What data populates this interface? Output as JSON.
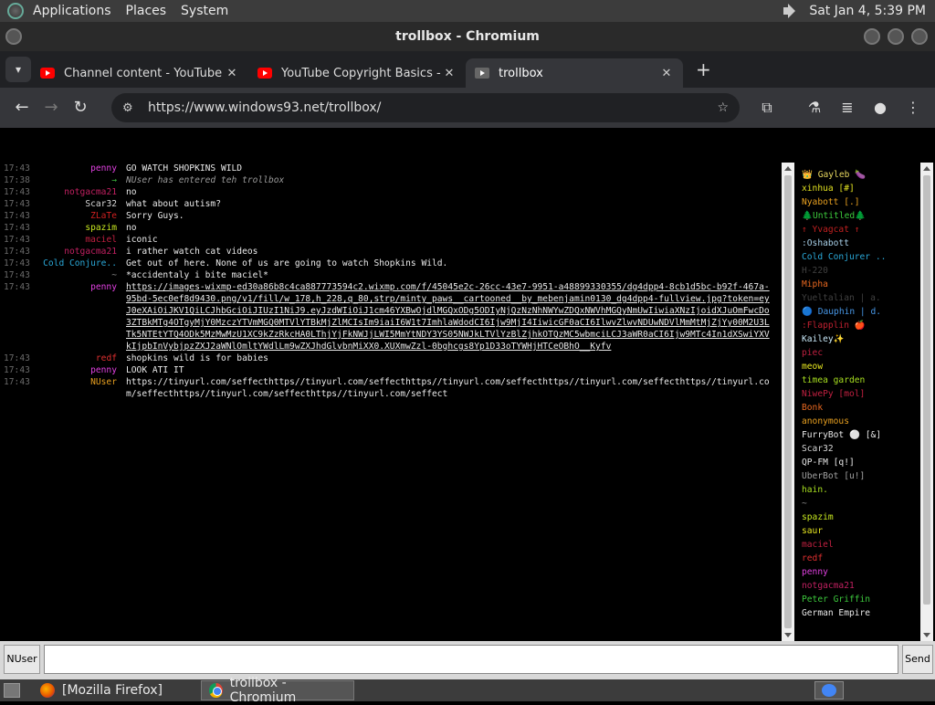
{
  "panel": {
    "menus": [
      "Applications",
      "Places",
      "System"
    ],
    "clock": "Sat Jan  4,  5:39 PM"
  },
  "window": {
    "title": "trollbox - Chromium"
  },
  "tabs": [
    {
      "title": "Channel content - YouTube S",
      "icon": "youtube-icon"
    },
    {
      "title": "YouTube Copyright Basics - Y",
      "icon": "youtube-icon"
    },
    {
      "title": "trollbox",
      "icon": "windows93-icon"
    }
  ],
  "toolbar": {
    "url": "https://www.windows93.net/trollbox/"
  },
  "chat": [
    {
      "time": "17:43",
      "nick": "penny",
      "color": "#e040e0",
      "msg": "GO WATCH SHOPKINS WILD"
    },
    {
      "time": "17:38",
      "nick": "→",
      "color": "#3fb83f",
      "msg": "NUser has entered teh trollbox",
      "system": true
    },
    {
      "time": "17:43",
      "nick": "notgacma21",
      "color": "#c02060",
      "msg": "no"
    },
    {
      "time": "17:43",
      "nick": "Scar32",
      "color": "#d8d8d8",
      "msg": "what about autism?"
    },
    {
      "time": "17:43",
      "nick": "ZLaTe",
      "color": "#d02020",
      "msg": "Sorry Guys."
    },
    {
      "time": "17:43",
      "nick": "spazim",
      "color": "#c8e820",
      "msg": "no"
    },
    {
      "time": "17:43",
      "nick": "maciel",
      "color": "#c02040",
      "msg": "iconic"
    },
    {
      "time": "17:43",
      "nick": "notgacma21",
      "color": "#c02060",
      "msg": "i rather watch cat videos"
    },
    {
      "time": "17:43",
      "nick": "Cold Conjure..",
      "color": "#2aa8d8",
      "msg": "Get out of here. None of us are going to watch Shopkins Wild."
    },
    {
      "time": "17:43",
      "nick": "~",
      "color": "#888888",
      "msg": "*accidentaly i bite maciel*"
    },
    {
      "time": "17:43",
      "nick": "penny",
      "color": "#e040e0",
      "msg": "https://images-wixmp-ed30a86b8c4ca887773594c2.wixmp.com/f/45045e2c-26cc-43e7-9951-a48899330355/dg4dpp4-8cb1d5bc-b92f-467a-95bd-5ec0ef8d9430.png/v1/fill/w_178,h_228,q_80,strp/minty_paws__cartooned__by_mebenjamin0130_dg4dpp4-fullview.jpg?token=eyJ0eXAiOiJKV1QiLCJhbGciOiJIUzI1NiJ9.eyJzdWIiOiJ1cm46YXBwOjdlMGQxODg5ODIyNjQzNzNhNWYwZDQxNWVhMGQyNmUwIiwiaXNzIjoidXJuOmFwcDo3ZTBkMTg4OTgyMjY0MzczYTVmMGQ0MTVlYTBkMjZlMCIsIm9iaiI6W1t7ImhlaWdodCI6Ijw9MjI4IiwicGF0aCI6IlwvZlwvNDUwNDVlMmMtMjZjYy00M2U3LTk5NTEtYTQ4ODk5MzMwMzU1XC9kZzRkcHA0LThjYjFkNWJjLWI5MmYtNDY3YS05NWJkLTVlYzBlZjhkOTQzMC5wbmciLCJ3aWR0aCI6Ijw9MTc4In1dXSwiYXVkIjpbInVybjpzZXJ2aWNlOmltYWdlLm9wZXJhdGlvbnMiXX0.XUXmwZzl-0bghcgs8Yp1D33oTYWHjHTCeOBhO__Kyfv",
      "link": true
    },
    {
      "time": "17:43",
      "nick": "redf",
      "color": "#e03030",
      "msg": "shopkins wild is for babies"
    },
    {
      "time": "17:43",
      "nick": "penny",
      "color": "#e040e0",
      "msg": "LOOK ATI IT"
    },
    {
      "time": "17:43",
      "nick": "NUser",
      "color": "#e8a020",
      "msg": "https://tinyurl.com/seffecthttps//tinyurl.com/seffecthttps//tinyurl.com/seffecthttps//tinyurl.com/seffecthttps//tinyurl.com/seffecthttps//tinyurl.com/seffecthttps//tinyurl.com/seffect"
    }
  ],
  "users": [
    {
      "name": "👑 Gayleb 🍆",
      "color": "#e8d860"
    },
    {
      "name": "xinhua [#]",
      "color": "#e0e020"
    },
    {
      "name": "Nyabott [.]",
      "color": "#e8a020"
    },
    {
      "name": "🌲Untitled🌲",
      "color": "#3cc83c"
    },
    {
      "name": "↑ Yvagcat ↑",
      "color": "#c02020"
    },
    {
      "name": ":Oshabott",
      "color": "#a8d0e8"
    },
    {
      "name": "Cold Conjurer ..",
      "color": "#2aa8d8"
    },
    {
      "name": "H-220",
      "color": "#404040"
    },
    {
      "name": "Mipha",
      "color": "#e86820"
    },
    {
      "name": "Yueltalian | a.",
      "color": "#404040"
    },
    {
      "name": "🔵 Dauphin | d.",
      "color": "#4898e8"
    },
    {
      "name": ":Flapplin 🍎",
      "color": "#c02030"
    },
    {
      "name": "Kailey✨",
      "color": "#c8e8f8"
    },
    {
      "name": "piec",
      "color": "#c02040"
    },
    {
      "name": "meow",
      "color": "#e8e820"
    },
    {
      "name": "timea garden",
      "color": "#a8e020"
    },
    {
      "name": "NiwePy [mol]",
      "color": "#c02040"
    },
    {
      "name": "Bonk",
      "color": "#e86820"
    },
    {
      "name": "anonymous",
      "color": "#e8a020"
    },
    {
      "name": "FurryBot ⚪ [&]",
      "color": "#e8e8e8"
    },
    {
      "name": "Scar32",
      "color": "#d8d8d8"
    },
    {
      "name": "QP-FM [q!]",
      "color": "#e8e8e8"
    },
    {
      "name": "UberBot [u!]",
      "color": "#a0a0a0"
    },
    {
      "name": "hain.",
      "color": "#a8e020"
    },
    {
      "name": "~",
      "color": "#888888"
    },
    {
      "name": "spazim",
      "color": "#c8e820"
    },
    {
      "name": "saur",
      "color": "#e8e820"
    },
    {
      "name": "maciel",
      "color": "#c02040"
    },
    {
      "name": "redf",
      "color": "#e03030"
    },
    {
      "name": "penny",
      "color": "#e040e0"
    },
    {
      "name": "notgacma21",
      "color": "#c02060"
    },
    {
      "name": "Peter Griffin",
      "color": "#3cc83c"
    },
    {
      "name": "German Empire",
      "color": "#e8e8e8"
    }
  ],
  "input": {
    "nick": "NUser",
    "value": "",
    "send": "Send"
  },
  "taskbar": [
    {
      "label": "[Mozilla Firefox]",
      "icon": "firefox-icon"
    },
    {
      "label": "trollbox - Chromium",
      "icon": "chromium-icon"
    }
  ]
}
